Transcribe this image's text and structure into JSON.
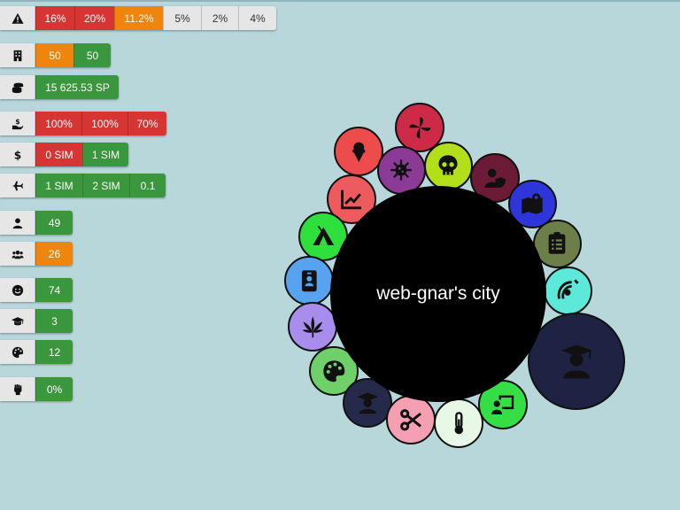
{
  "city": {
    "name": "web-gnar's city"
  },
  "stats": {
    "danger": [
      "16%",
      "20%",
      "11.2%",
      "5%",
      "2%",
      "4%"
    ],
    "buildings": [
      "50",
      "50"
    ],
    "money": "15 625.53 SP",
    "tax": [
      "100%",
      "100%",
      "70%"
    ],
    "cash": [
      "0 SIM",
      "1 SIM"
    ],
    "travel": [
      "1 SIM",
      "2 SIM",
      "0.1"
    ],
    "citizens": "49",
    "groups": "26",
    "happiness": "74",
    "education": "3",
    "culture": "12",
    "protest": "0%"
  },
  "icons": {
    "danger": "warning-icon",
    "buildings": "building-icon",
    "money": "coins-stack-icon",
    "tax": "hand-money-icon",
    "cash": "dollar-icon",
    "travel": "airplane-icon",
    "citizens": "user-icon",
    "groups": "users-icon",
    "happiness": "smile-icon",
    "education": "graduation-cap-icon",
    "culture": "palette-icon",
    "protest": "raised-fist-icon"
  },
  "colors": {
    "background": "#b7d7db",
    "red": "#d63533",
    "orange": "#f0850d",
    "green": "#3a973d",
    "grey": "#e6e6e6",
    "center": "#000000"
  },
  "bubbles": [
    {
      "name": "pinwheel-icon",
      "color": "#cc2a47"
    },
    {
      "name": "ice-cream-icon",
      "color": "#ee4c4c"
    },
    {
      "name": "virus-icon",
      "color": "#8b3a96"
    },
    {
      "name": "skull-icon",
      "color": "#b3de1a"
    },
    {
      "name": "user-shield-icon",
      "color": "#6b1b36"
    },
    {
      "name": "map-location-icon",
      "color": "#2e36d9"
    },
    {
      "name": "clipboard-list-icon",
      "color": "#6d7f49"
    },
    {
      "name": "chart-line-icon",
      "color": "#ee5b5f"
    },
    {
      "name": "campground-icon",
      "color": "#2de03b"
    },
    {
      "name": "id-badge-icon",
      "color": "#57a3ef"
    },
    {
      "name": "cannabis-icon",
      "color": "#a98ded"
    },
    {
      "name": "palette-icon",
      "color": "#6fcf69"
    },
    {
      "name": "teacher-icon",
      "color": "#262a4a"
    },
    {
      "name": "scissors-icon",
      "color": "#f59fb3"
    },
    {
      "name": "thermometer-icon",
      "color": "#e7f9e6"
    },
    {
      "name": "chalkboard-teacher-icon",
      "color": "#35de45"
    },
    {
      "name": "satellite-icon",
      "color": "#5de9d9"
    },
    {
      "name": "graduate-icon",
      "color": "#1f2343"
    }
  ]
}
